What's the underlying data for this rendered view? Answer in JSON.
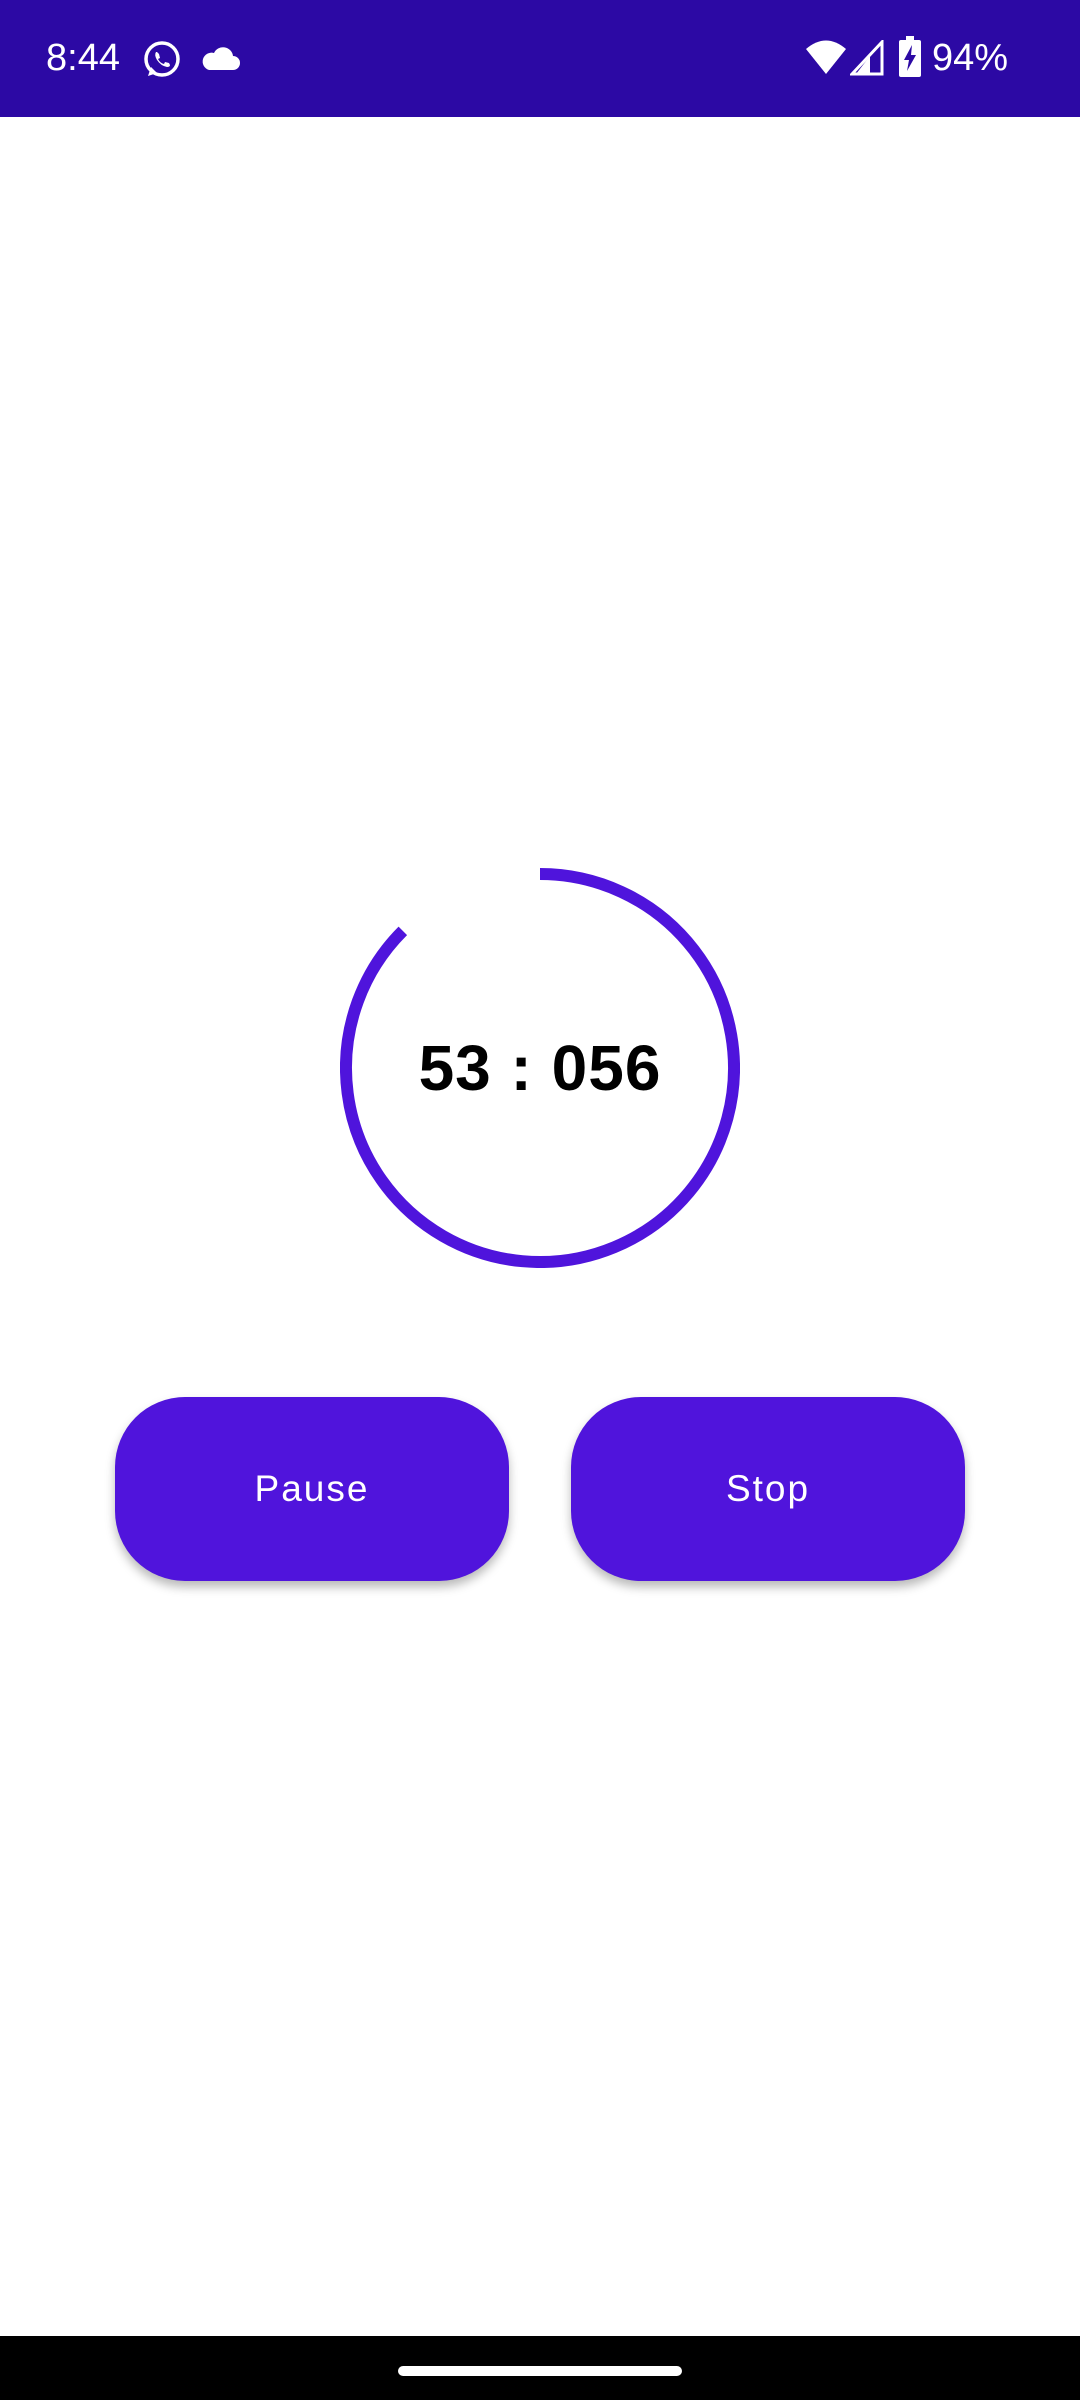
{
  "status_bar": {
    "time": "8:44",
    "battery": "94%",
    "background": "#2c09a4",
    "icons": {
      "whatsapp": "whatsapp-icon",
      "cloud": "cloud-icon",
      "wifi": "wifi-icon",
      "signal": "signal-icon",
      "battery": "battery-charging-icon"
    }
  },
  "timer": {
    "display": "53 : 056",
    "ring_color": "#4f14dc",
    "progress_fraction": 0.875
  },
  "buttons": {
    "pause_label": "Pause",
    "stop_label": "Stop",
    "color": "#5014dc"
  }
}
